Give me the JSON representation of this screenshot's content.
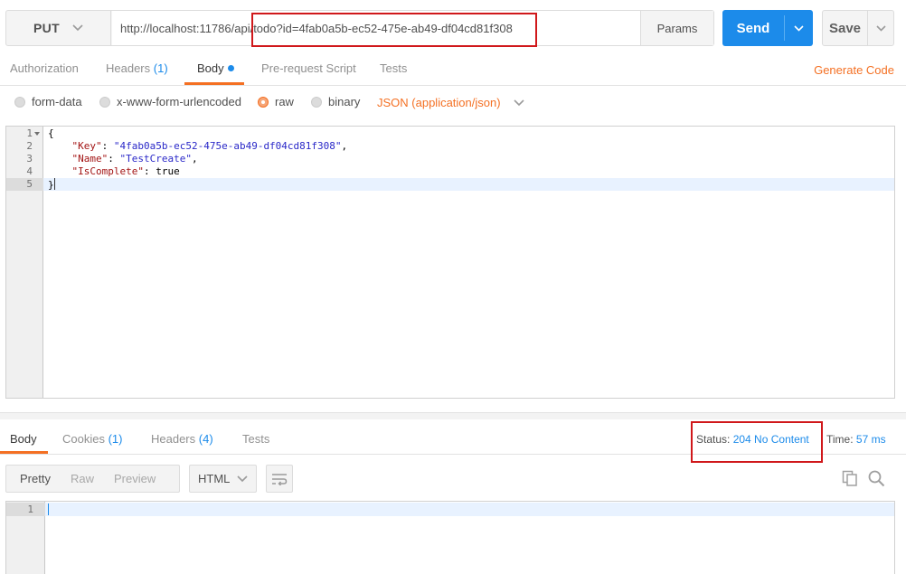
{
  "request": {
    "method": "PUT",
    "url": "http://localhost:11786/api/todo?id=4fab0a5b-ec52-475e-ab49-df04cd81f308",
    "params_label": "Params",
    "send_label": "Send",
    "save_label": "Save"
  },
  "request_tabs": [
    {
      "label": "Authorization"
    },
    {
      "label": "Headers",
      "count": "(1)"
    },
    {
      "label": "Body",
      "active": true
    },
    {
      "label": "Pre-request Script"
    },
    {
      "label": "Tests"
    }
  ],
  "generate_code_label": "Generate Code",
  "body_types": [
    {
      "label": "form-data",
      "selected": false
    },
    {
      "label": "x-www-form-urlencoded",
      "selected": false
    },
    {
      "label": "raw",
      "selected": true
    },
    {
      "label": "binary",
      "selected": false
    }
  ],
  "content_type": "JSON (application/json)",
  "editor": {
    "line_numbers": [
      "1",
      "2",
      "3",
      "4",
      "5"
    ],
    "lines": [
      "{",
      "    \"Key\": \"4fab0a5b-ec52-475e-ab49-df04cd81f308\",",
      "    \"Name\": \"TestCreate\",",
      "    \"IsComplete\": true",
      "}"
    ],
    "key_key": "\"Key\"",
    "key_value": "\"4fab0a5b-ec52-475e-ab49-df04cd81f308\"",
    "name_key": "\"Name\"",
    "name_value": "\"TestCreate\"",
    "complete_key": "\"IsComplete\"",
    "complete_value": "true",
    "open_brace": "{",
    "close_brace": "}"
  },
  "response_tabs": [
    {
      "label": "Body",
      "active": true
    },
    {
      "label": "Cookies",
      "count": "(1)"
    },
    {
      "label": "Headers",
      "count": "(4)"
    },
    {
      "label": "Tests"
    }
  ],
  "response_meta": {
    "status_label": "Status:",
    "status_value": "204 No Content",
    "time_label": "Time:",
    "time_value": "57 ms"
  },
  "response_view": {
    "modes": [
      "Pretty",
      "Raw",
      "Preview"
    ],
    "format": "HTML",
    "line_number": "1"
  },
  "colors": {
    "accent_orange": "#f47023",
    "primary_blue": "#1c8bea",
    "highlight_red": "#d0181b"
  }
}
